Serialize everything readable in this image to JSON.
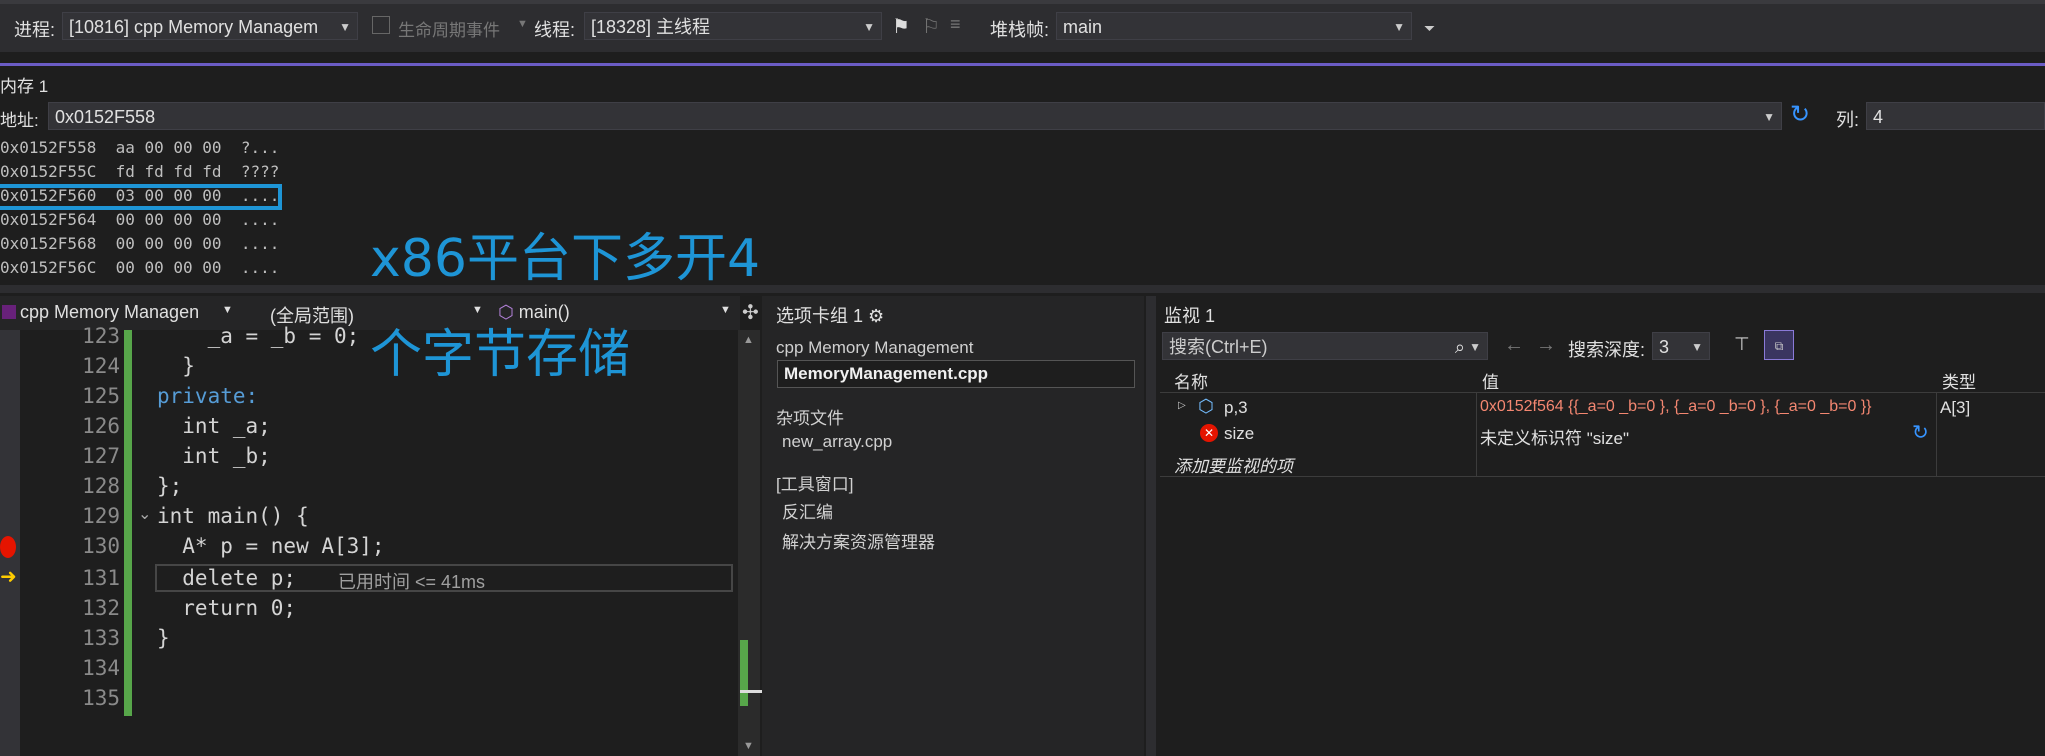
{
  "toolbar": {
    "process_label": "进程:",
    "process_value": "[10816] cpp Memory Managem",
    "lifecycle_label": "生命周期事件",
    "thread_label": "线程:",
    "thread_value": "[18328] 主线程",
    "stack_label": "堆栈帧:",
    "stack_value": "main"
  },
  "memory": {
    "title": "内存 1",
    "address_label": "地址:",
    "address_value": "0x0152F558",
    "columns_label": "列:",
    "columns_value": "4",
    "rows": [
      {
        "addr": "0x0152F558",
        "bytes": "aa 00 00 00",
        "ascii": "?..."
      },
      {
        "addr": "0x0152F55C",
        "bytes": "fd fd fd fd",
        "ascii": "????"
      },
      {
        "addr": "0x0152F560",
        "bytes": "03 00 00 00",
        "ascii": "...."
      },
      {
        "addr": "0x0152F564",
        "bytes": "00 00 00 00",
        "ascii": "...."
      },
      {
        "addr": "0x0152F568",
        "bytes": "00 00 00 00",
        "ascii": "...."
      },
      {
        "addr": "0x0152F56C",
        "bytes": "00 00 00 00",
        "ascii": "...."
      }
    ]
  },
  "annotation": {
    "line1": "x86平台下多开4",
    "line2": "个字节存储"
  },
  "editor": {
    "project_dropdown": "cpp Memory Managen",
    "scope_dropdown": "(全局范围)",
    "function_dropdown": "main()",
    "lines": [
      {
        "num": "123",
        "code": "    _a = _b = 0;"
      },
      {
        "num": "124",
        "code": "  }"
      },
      {
        "num": "125",
        "code": "private:"
      },
      {
        "num": "126",
        "code": "  int _a;"
      },
      {
        "num": "127",
        "code": "  int _b;"
      },
      {
        "num": "128",
        "code": "};"
      },
      {
        "num": "129",
        "code": "int main() {"
      },
      {
        "num": "130",
        "code": "  A* p = new A[3];"
      },
      {
        "num": "131",
        "code": "  delete p;"
      },
      {
        "num": "132",
        "code": "  return 0;"
      },
      {
        "num": "133",
        "code": "}"
      },
      {
        "num": "134",
        "code": ""
      },
      {
        "num": "135",
        "code": ""
      }
    ],
    "elapsed_hint": "已用时间 <= 41ms"
  },
  "tab_group": {
    "title": "选项卡组 1",
    "project": "cpp Memory Management",
    "selected_file": "MemoryManagement.cpp",
    "misc_header": "杂项文件",
    "misc_file": "new_array.cpp",
    "tools_header": "[工具窗口]",
    "tool1": "反汇编",
    "tool2": "解决方案资源管理器"
  },
  "watch": {
    "title": "监视 1",
    "search_placeholder": "搜索(Ctrl+E)",
    "depth_label": "搜索深度:",
    "depth_value": "3",
    "col_name": "名称",
    "col_value": "值",
    "col_type": "类型",
    "rows": [
      {
        "name": "p,3",
        "value": "0x0152f564 {{_a=0 _b=0 }, {_a=0 _b=0 }, {_a=0 _b=0 }}",
        "type": "A[3]"
      },
      {
        "name": "size",
        "value": "未定义标识符 \"size\"",
        "type": ""
      }
    ],
    "add_item": "添加要监视的项"
  },
  "colors": {
    "accent_purple": "#6b5cc5",
    "annotation_blue": "#1e95d6",
    "breakpoint_red": "#e51400",
    "change_green": "#57a64a",
    "error_value_red": "#f48771"
  }
}
